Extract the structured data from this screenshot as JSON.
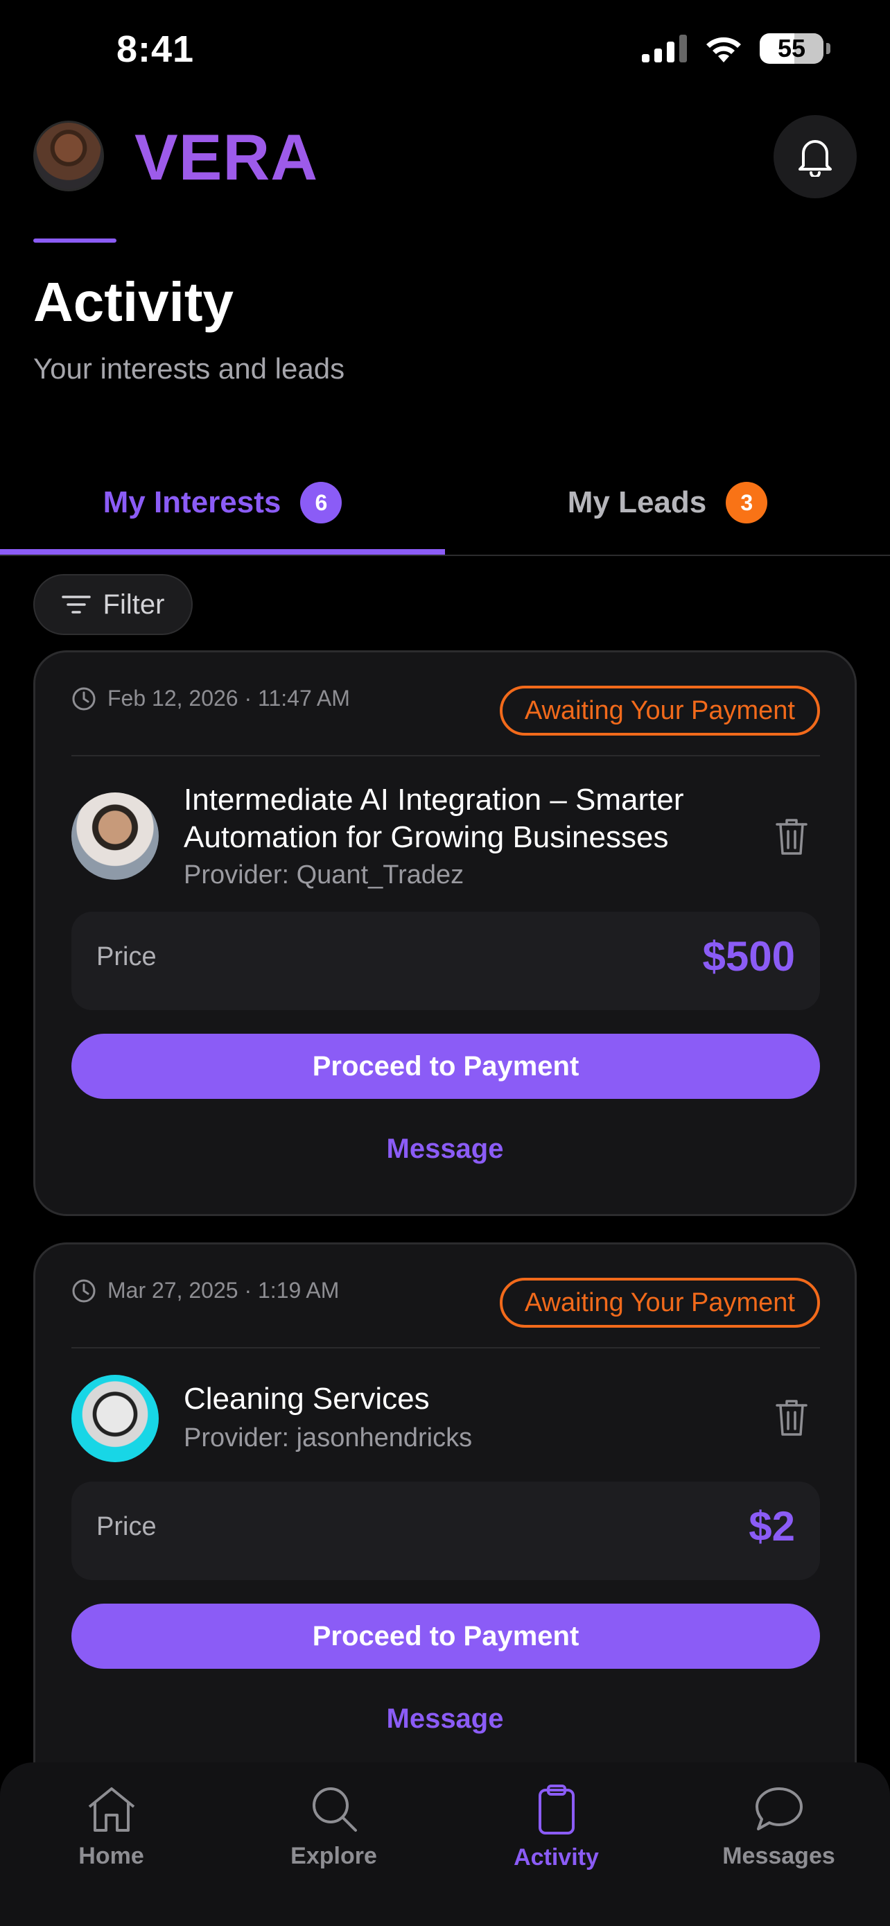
{
  "status_bar": {
    "time": "8:41",
    "battery": "55"
  },
  "header": {
    "brand": "VERA"
  },
  "page": {
    "title": "Activity",
    "subtitle": "Your interests and leads"
  },
  "tabs": [
    {
      "label": "My Interests",
      "count": "6",
      "active": true
    },
    {
      "label": "My Leads",
      "count": "3",
      "active": false
    }
  ],
  "filter": {
    "label": "Filter"
  },
  "cards": [
    {
      "datetime": "Feb 12, 2026 · 11:47 AM",
      "status": "Awaiting Your Payment",
      "title": "Intermediate AI Integration – Smarter Automation for Growing Businesses",
      "provider": "Provider: Quant_Tradez",
      "price_label": "Price",
      "price": "$500",
      "pay_label": "Proceed to Payment",
      "message_label": "Message"
    },
    {
      "datetime": "Mar 27, 2025 · 1:19 AM",
      "status": "Awaiting Your Payment",
      "title": "Cleaning Services",
      "provider": "Provider: jasonhendricks",
      "price_label": "Price",
      "price": "$2",
      "pay_label": "Proceed to Payment",
      "message_label": "Message"
    }
  ],
  "tabbar": [
    {
      "label": "Home",
      "icon": "home-icon"
    },
    {
      "label": "Explore",
      "icon": "search-icon"
    },
    {
      "label": "Activity",
      "icon": "clipboard-icon",
      "active": true
    },
    {
      "label": "Messages",
      "icon": "chat-bubble-icon"
    }
  ],
  "colors": {
    "accent": "#8b5cf6",
    "brand": "#9d5bea",
    "status_orange": "#f26a1b",
    "background": "#000000"
  }
}
